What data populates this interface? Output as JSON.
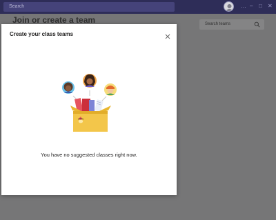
{
  "topbar": {
    "search_placeholder": "Search",
    "controls": [
      "…",
      "–",
      "□",
      "✕"
    ]
  },
  "background": {
    "page_title": "Join or create a team",
    "search_teams_placeholder": "Search teams"
  },
  "modal": {
    "title": "Create your class teams",
    "close_label": "Close",
    "empty_message": "You have no suggested classes right now."
  },
  "colors": {
    "topbar": "#2e2d58",
    "overlay": "#767677",
    "modal_bg": "#ffffff",
    "box_yellow": "#f3c64a"
  }
}
